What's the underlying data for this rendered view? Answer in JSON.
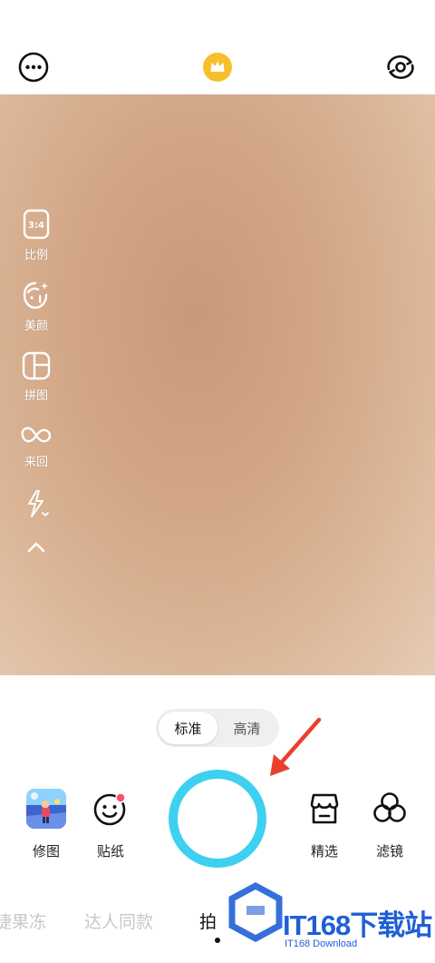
{
  "header": {
    "more_icon": "more-horizontal-icon",
    "vip_icon": "crown-icon",
    "vip_color": "#f5c02a",
    "flip_icon": "camera-flip-icon"
  },
  "side_toolbar": {
    "ratio": {
      "icon_text": "3:4",
      "label": "比例"
    },
    "beauty": {
      "label": "美颜"
    },
    "collage": {
      "label": "拼图"
    },
    "boomerang": {
      "label": "来回"
    },
    "flash_icon": "flash-auto-icon",
    "collapse_icon": "chevron-up-icon"
  },
  "quality": {
    "options": [
      "标准",
      "高清"
    ],
    "selected": "标准"
  },
  "tools": {
    "edit": {
      "label": "修图"
    },
    "sticker": {
      "label": "贴纸"
    },
    "featured": {
      "label": "精选"
    },
    "filter": {
      "label": "滤镜"
    }
  },
  "shutter": {
    "color": "#3ed0f0"
  },
  "modes": {
    "items": [
      "捷果冻",
      "达人同款",
      "拍"
    ],
    "active": "拍"
  },
  "watermark": {
    "brand": "IT168下载站",
    "sub": "IT168 Download"
  },
  "colors": {
    "accent": "#3ed0f0",
    "arrow": "#e8402e",
    "badge": "#ff4d6d",
    "watermark": "#1f5fd6"
  }
}
